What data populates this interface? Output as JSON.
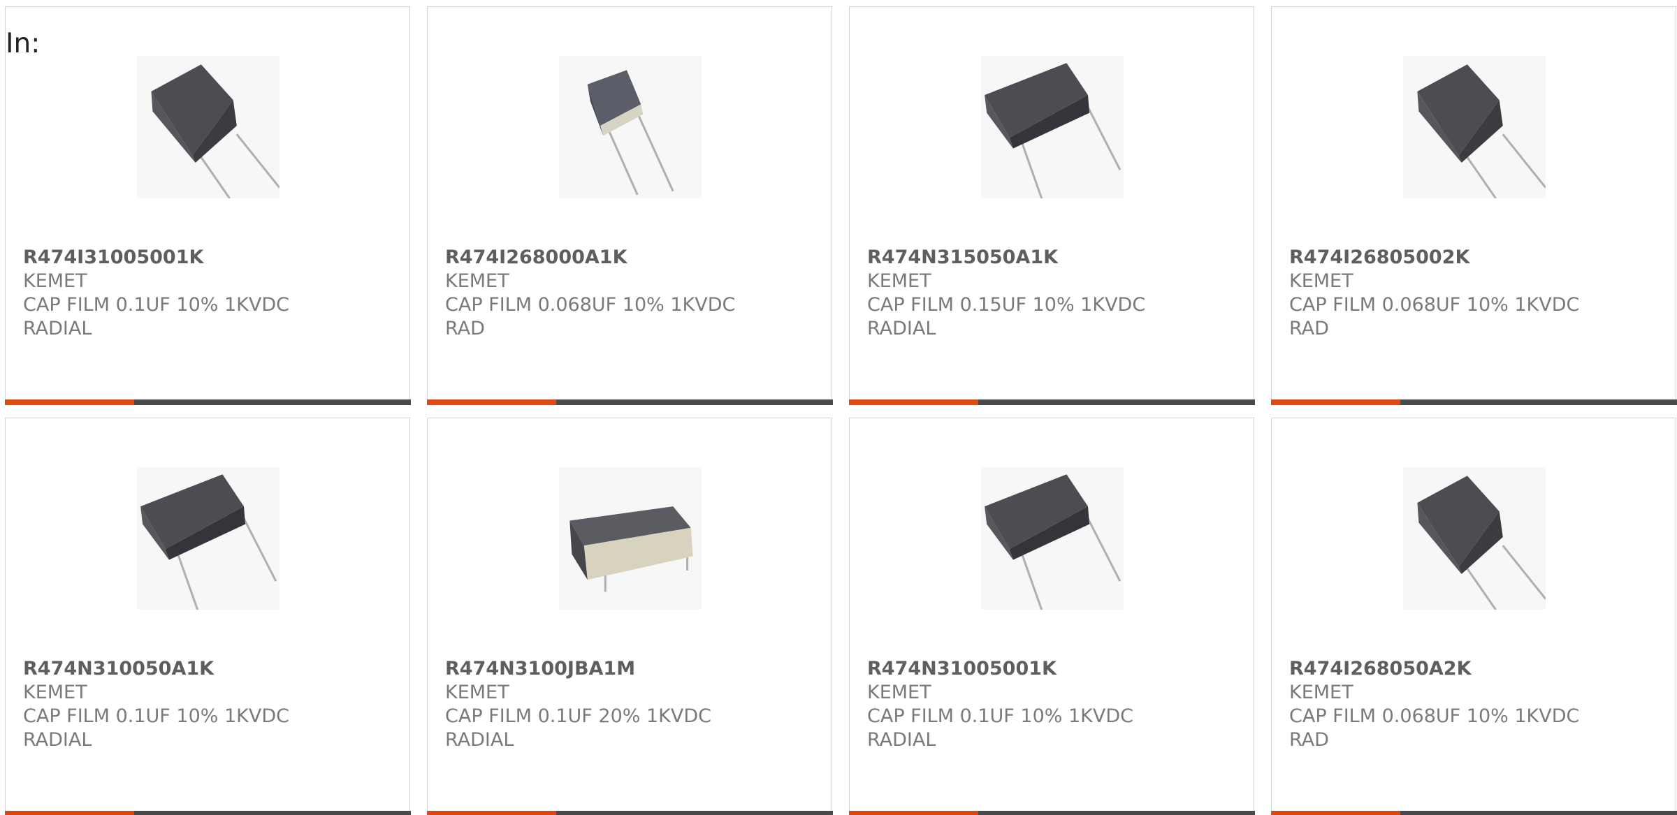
{
  "header": {
    "label": "In:"
  },
  "accent_color": "#e04811",
  "bar_color": "#4a4a4a",
  "products": [
    {
      "part": "R474I31005001K",
      "maker": "KEMET",
      "desc": "CAP FILM 0.1UF 10% 1KVDC",
      "desc2": "RADIAL",
      "icon": "film-capacitor-image"
    },
    {
      "part": "R474I268000A1K",
      "maker": "KEMET",
      "desc": "CAP FILM 0.068UF 10% 1KVDC",
      "desc2": "RAD",
      "icon": "film-capacitor-image"
    },
    {
      "part": "R474N315050A1K",
      "maker": "KEMET",
      "desc": "CAP FILM 0.15UF 10% 1KVDC",
      "desc2": "RADIAL",
      "icon": "film-capacitor-image"
    },
    {
      "part": "R474I26805002K",
      "maker": "KEMET",
      "desc": "CAP FILM 0.068UF 10% 1KVDC",
      "desc2": "RAD",
      "icon": "film-capacitor-image"
    },
    {
      "part": "R474N310050A1K",
      "maker": "KEMET",
      "desc": "CAP FILM 0.1UF 10% 1KVDC",
      "desc2": "RADIAL",
      "icon": "film-capacitor-image"
    },
    {
      "part": "R474N3100JBA1M",
      "maker": "KEMET",
      "desc": "CAP FILM 0.1UF 20% 1KVDC",
      "desc2": "RADIAL",
      "icon": "film-capacitor-image"
    },
    {
      "part": "R474N31005001K",
      "maker": "KEMET",
      "desc": "CAP FILM 0.1UF 10% 1KVDC",
      "desc2": "RADIAL",
      "icon": "film-capacitor-image"
    },
    {
      "part": "R474I268050A2K",
      "maker": "KEMET",
      "desc": "CAP FILM 0.068UF 10% 1KVDC",
      "desc2": "RAD",
      "icon": "film-capacitor-image"
    }
  ]
}
